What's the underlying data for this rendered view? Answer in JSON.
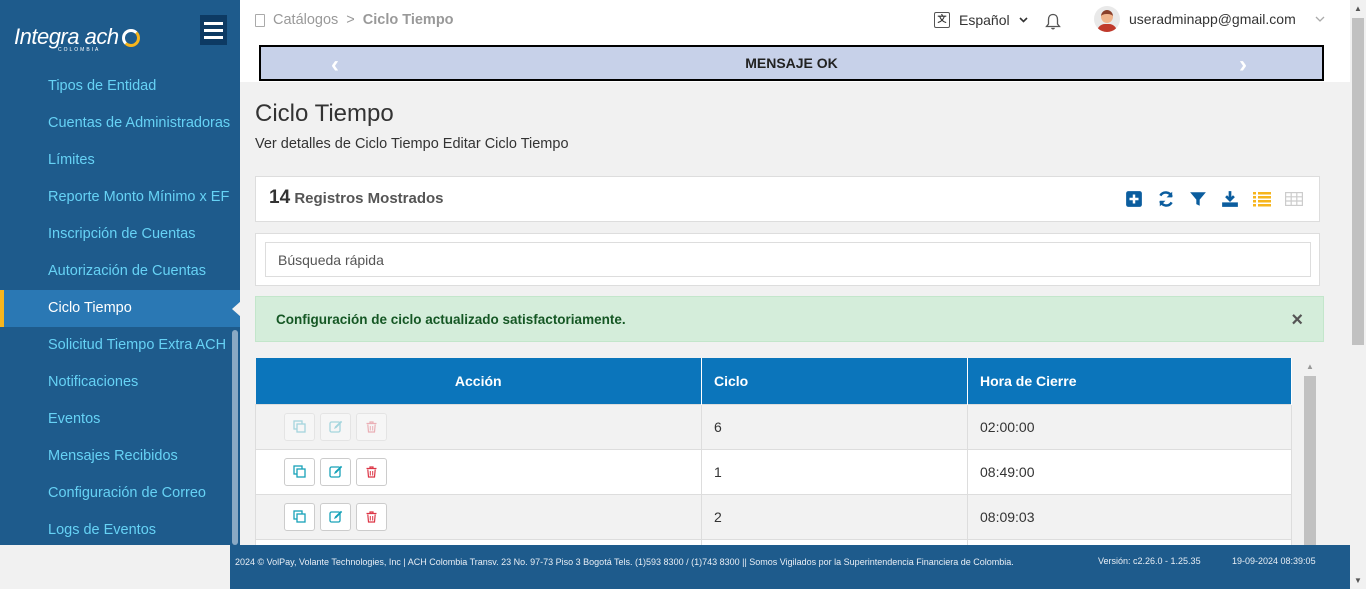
{
  "sidebar": {
    "logo": {
      "brand": "Integra ach",
      "sub": "COLOMBIA"
    },
    "items": [
      {
        "label": "Tipos de Entidad"
      },
      {
        "label": "Cuentas de Administradoras"
      },
      {
        "label": "Límites"
      },
      {
        "label": "Reporte Monto Mínimo x EF"
      },
      {
        "label": "Inscripción de Cuentas"
      },
      {
        "label": "Autorización de Cuentas"
      },
      {
        "label": "Ciclo Tiempo",
        "active": true
      },
      {
        "label": "Solicitud Tiempo Extra ACH"
      },
      {
        "label": "Notificaciones"
      },
      {
        "label": "Eventos"
      },
      {
        "label": "Mensajes Recibidos"
      },
      {
        "label": "Configuración de Correo"
      },
      {
        "label": "Logs de Eventos"
      }
    ]
  },
  "header": {
    "breadcrumb": {
      "parent": "Catálogos",
      "separator": ">",
      "current": "Ciclo Tiempo"
    },
    "language": "Español",
    "user_email": "useradminapp@gmail.com",
    "message_bar": "MENSAJE OK"
  },
  "main": {
    "title": "Ciclo Tiempo",
    "subtitle": "Ver detalles de Ciclo Tiempo Editar Ciclo Tiempo",
    "records_count": "14",
    "records_label": "Registros Mostrados",
    "search_placeholder": "Búsqueda rápida",
    "alert": "Configuración de ciclo actualizado satisfactoriamente.",
    "alert_close": "×",
    "table": {
      "headers": [
        "Acción",
        "Ciclo",
        "Hora de Cierre"
      ],
      "rows": [
        {
          "ciclo": "6",
          "hora": "02:00:00",
          "disabled": true
        },
        {
          "ciclo": "1",
          "hora": "08:49:00",
          "disabled": false
        },
        {
          "ciclo": "2",
          "hora": "08:09:03",
          "disabled": false
        }
      ]
    }
  },
  "footer": {
    "copyright": "2024 © VolPay, Volante Technologies, Inc | ACH Colombia Transv. 23 No. 97-73 Piso 3 Bogotá Tels. (1)593 8300 / (1)743 8300 || Somos Vigilados por la Superintendencia Financiera de Colombia.",
    "version": "Versión: c2.26.0 - 1.25.35",
    "datetime": "19-09-2024 08:39:05"
  },
  "colors": {
    "sidebar_bg": "#1e5b8c",
    "nav_text": "#66d2f5",
    "accent": "#f6b51d",
    "table_header": "#0b75bb",
    "alert_bg": "#d4edda",
    "tool_icon": "#0b5d9e"
  },
  "icons": [
    "catalog-icon",
    "language-icon",
    "bell-icon",
    "avatar",
    "add-icon",
    "refresh-icon",
    "filter-icon",
    "download-icon",
    "list-view-icon",
    "grid-view-icon",
    "copy-icon",
    "edit-icon",
    "delete-icon"
  ]
}
